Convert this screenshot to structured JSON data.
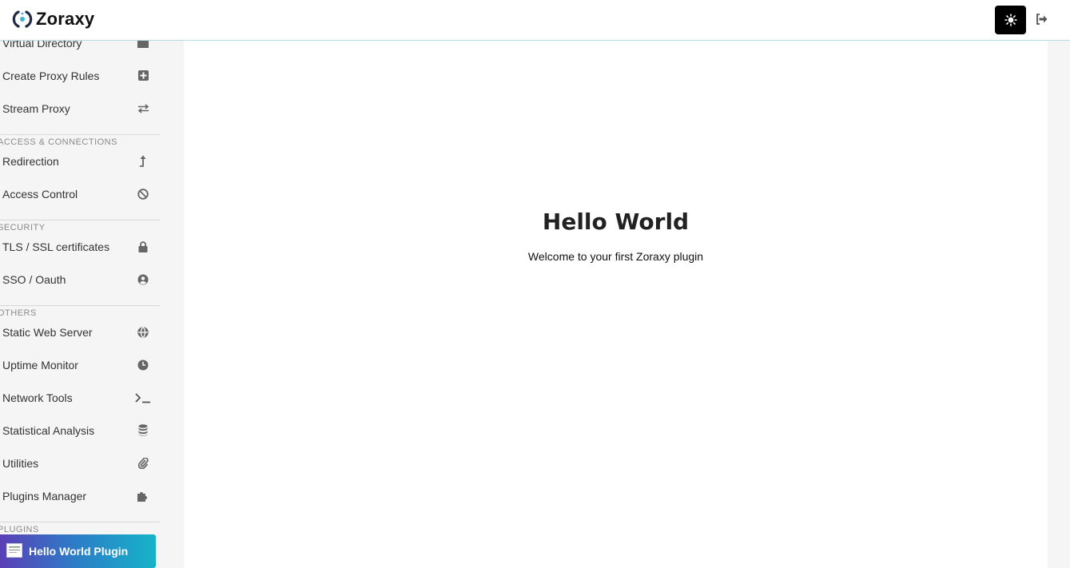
{
  "app": {
    "name": "Zoraxy"
  },
  "header": {
    "theme_icon": "sun-icon",
    "logout_icon": "logout-icon"
  },
  "sidebar": {
    "items_top": [
      {
        "label": "Virtual Directory",
        "icon": "folder-icon"
      },
      {
        "label": "Create Proxy Rules",
        "icon": "plus-square-icon"
      },
      {
        "label": "Stream Proxy",
        "icon": "exchange-icon"
      }
    ],
    "sections": [
      {
        "title": "ACCESS & CONNECTIONS",
        "items": [
          {
            "label": "Redirection",
            "icon": "level-up-icon"
          },
          {
            "label": "Access Control",
            "icon": "ban-icon"
          }
        ]
      },
      {
        "title": "SECURITY",
        "items": [
          {
            "label": "TLS / SSL certificates",
            "icon": "lock-icon"
          },
          {
            "label": "SSO / Oauth",
            "icon": "user-circle-icon"
          }
        ]
      },
      {
        "title": "OTHERS",
        "items": [
          {
            "label": "Static Web Server",
            "icon": "globe-icon"
          },
          {
            "label": "Uptime Monitor",
            "icon": "clock-icon"
          },
          {
            "label": "Network Tools",
            "icon": "terminal-icon"
          },
          {
            "label": "Statistical Analysis",
            "icon": "database-icon"
          },
          {
            "label": "Utilities",
            "icon": "paperclip-icon"
          },
          {
            "label": "Plugins Manager",
            "icon": "puzzle-icon"
          }
        ]
      },
      {
        "title": "PLUGINS",
        "items": []
      }
    ],
    "active_plugin": {
      "label": "Hello World Plugin"
    }
  },
  "main": {
    "title": "Hello World",
    "subtitle": "Welcome to your first Zoraxy plugin"
  }
}
